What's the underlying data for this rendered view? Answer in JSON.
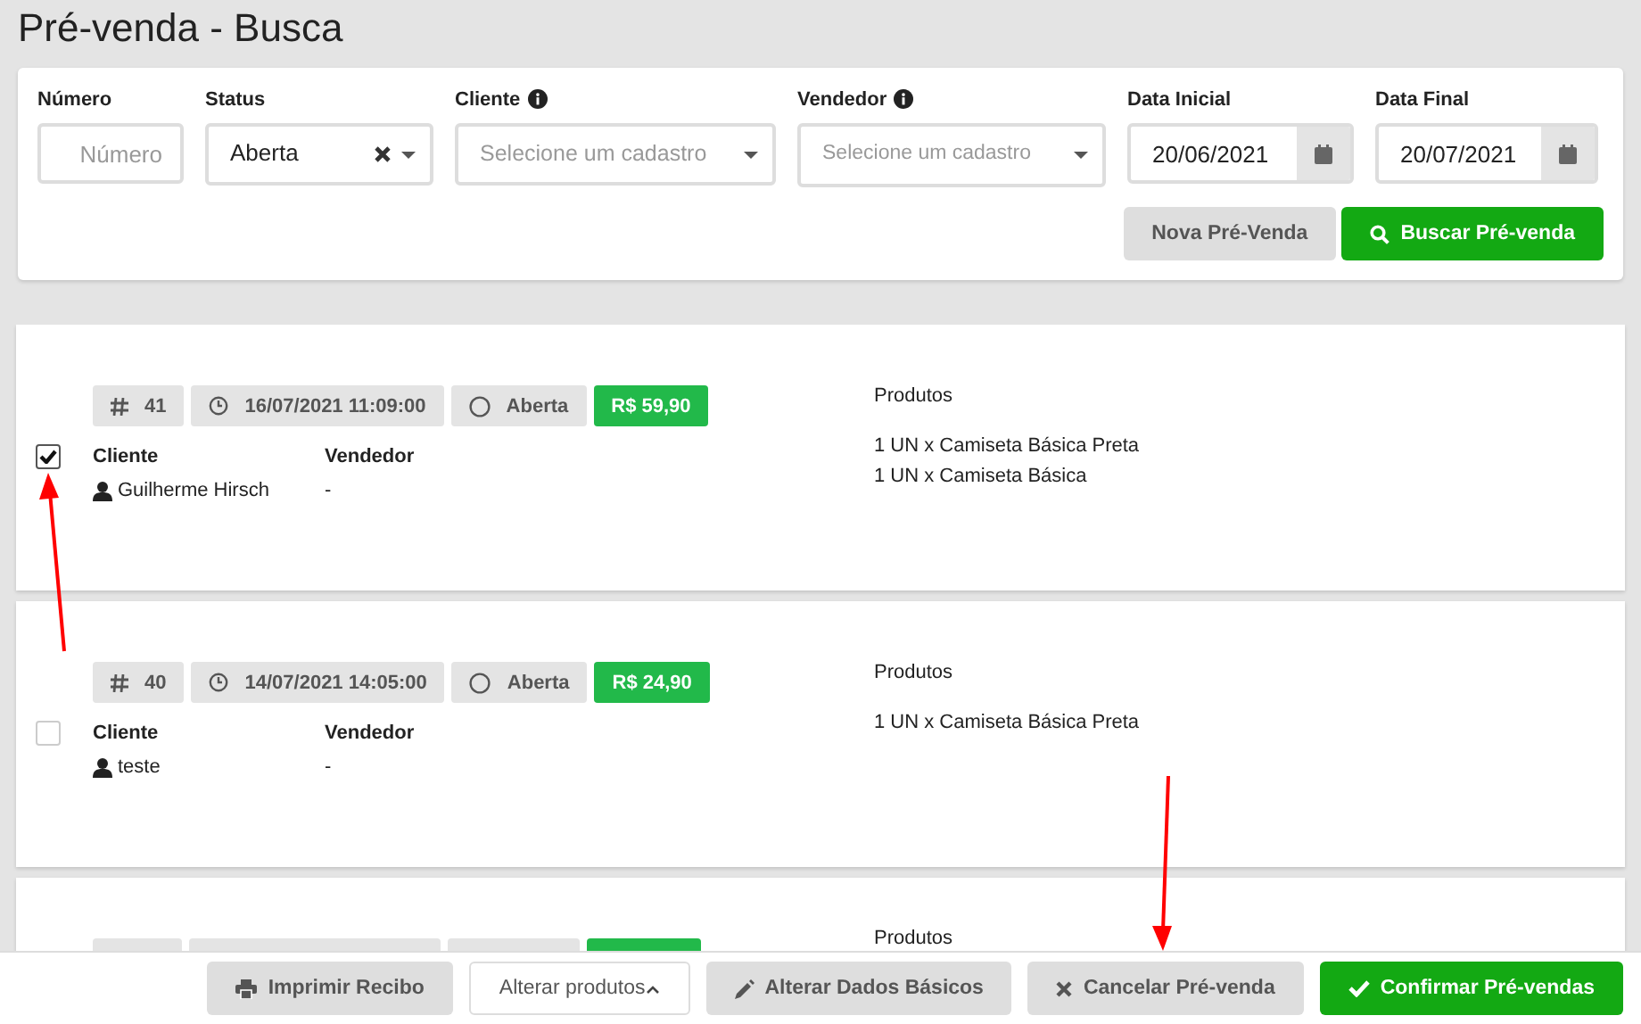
{
  "page_title": "Pré-venda - Busca",
  "filters": {
    "numero": {
      "label": "Número",
      "placeholder": "Número"
    },
    "status": {
      "label": "Status",
      "value": "Aberta"
    },
    "cliente": {
      "label": "Cliente",
      "placeholder": "Selecione um cadastro"
    },
    "vendedor": {
      "label": "Vendedor",
      "placeholder": "Selecione um cadastro"
    },
    "data_inicial": {
      "label": "Data Inicial",
      "value": "20/06/2021"
    },
    "data_final": {
      "label": "Data Final",
      "value": "20/07/2021"
    },
    "buttons": [
      {
        "label": "Nova Pré-Venda",
        "kind": "secondary"
      },
      {
        "label": "Buscar Pré-venda",
        "kind": "search"
      }
    ]
  },
  "orders": [
    {
      "checked": true,
      "number": "41",
      "datetime": "16/07/2021 11:09:00",
      "status": "Aberta",
      "total": "R$ 59,90",
      "cliente_label": "Cliente",
      "cliente": "Guilherme Hirsch",
      "vendedor_label": "Vendedor",
      "vendedor": "-",
      "products_title": "Produtos",
      "products": [
        "1 UN x Camiseta Básica Preta",
        "1 UN x Camiseta Básica"
      ]
    },
    {
      "checked": false,
      "number": "40",
      "datetime": "14/07/2021 14:05:00",
      "status": "Aberta",
      "total": "R$ 24,90",
      "cliente_label": "Cliente",
      "cliente": "teste",
      "vendedor_label": "Vendedor",
      "vendedor": "-",
      "products_title": "Produtos",
      "products": [
        "1 UN x Camiseta Básica Preta"
      ]
    }
  ],
  "partial_order": {
    "products_title": "Produtos"
  },
  "footer_buttons": [
    {
      "label": "Imprimir Recibo",
      "kind": "print"
    },
    {
      "label": "Alterar produtos",
      "kind": "dropup"
    },
    {
      "label": "Alterar Dados Básicos",
      "kind": "edit"
    },
    {
      "label": "Cancelar Pré-venda",
      "kind": "cancel"
    },
    {
      "label": "Confirmar Pré-vendas",
      "kind": "confirm"
    }
  ]
}
